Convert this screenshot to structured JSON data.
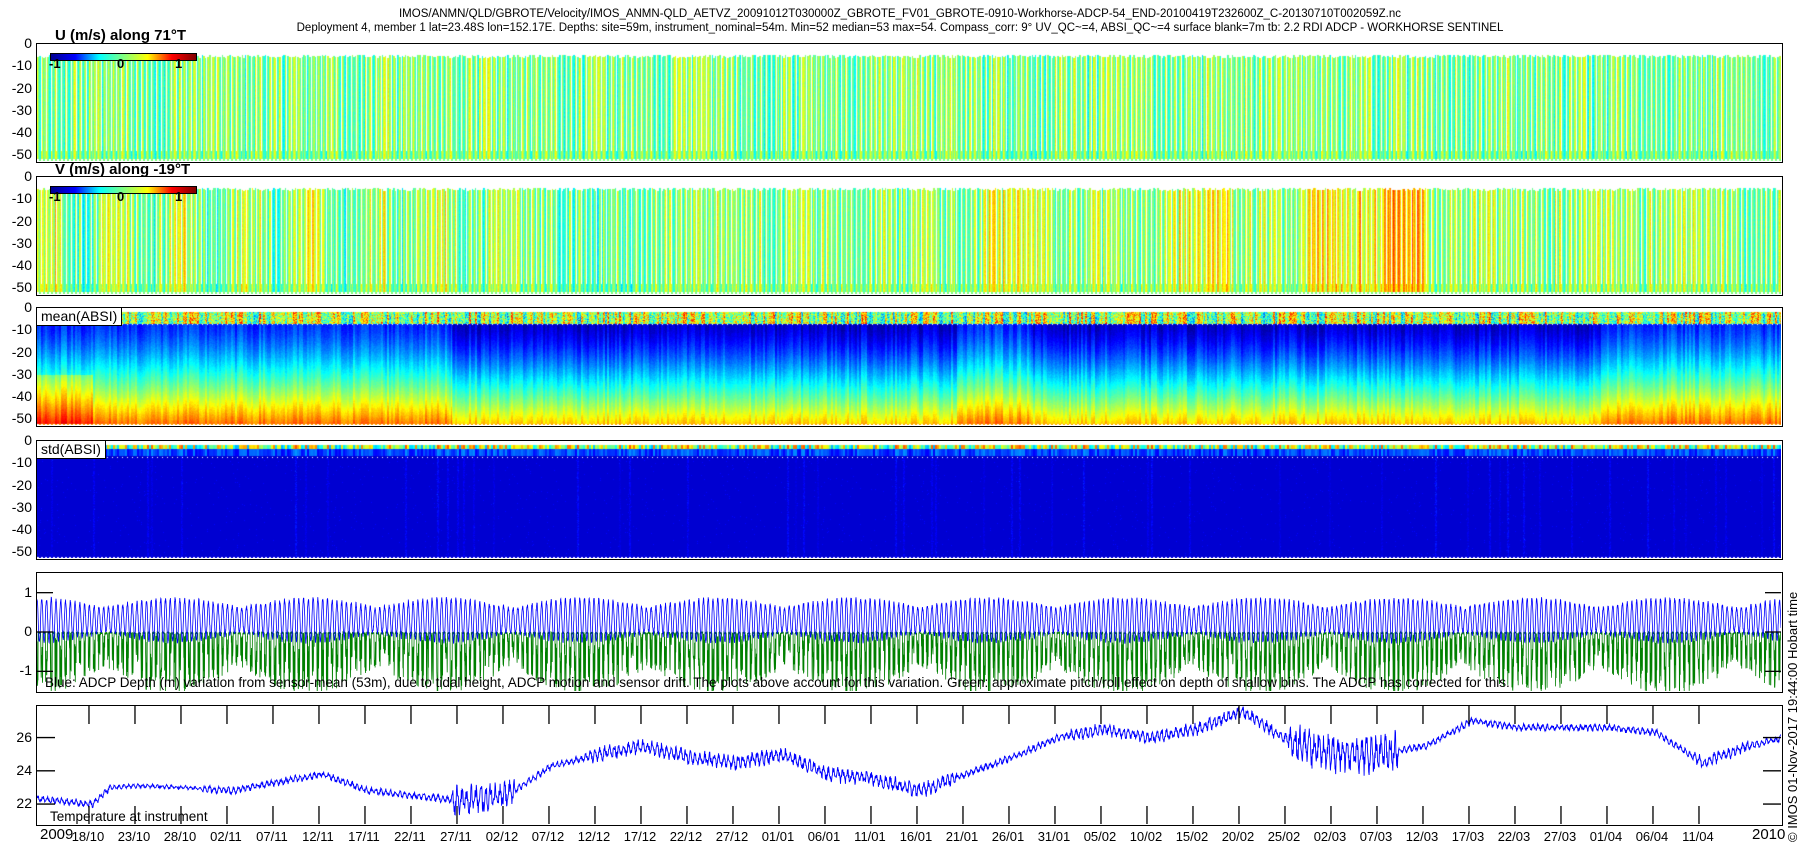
{
  "title": {
    "line1": "IMOS/ANMN/QLD/GBROTE/Velocity/IMOS_ANMN-QLD_AETVZ_20091012T030000Z_GBROTE_FV01_GBROTE-0910-Workhorse-ADCP-54_END-20100419T232600Z_C-20130710T002059Z.nc",
    "line2": "Deployment 4, member 1 lat=23.48S lon=152.17E. Depths: site=59m, instrument_nominal=54m. Min=52 median=53 max=54. Compass_corr: 9° UV_QC~=4, ABSI_QC~=4 surface blank=7m tb: 2.2 RDI ADCP - WORKHORSE SENTINEL"
  },
  "credit": "© IMOS 01-Nov-2017 19:44:00 Hobart time",
  "colors": {
    "blue_series": "#0000ff",
    "green_series": "#008000"
  },
  "chart_data": [
    {
      "type": "heatmap",
      "name": "u",
      "title": "U (m/s) along 71°T",
      "ylabel_ticks": [
        "0",
        "-10",
        "-20",
        "-30",
        "-40",
        "-50"
      ],
      "ylim": [
        -52.5,
        0
      ],
      "clim": [
        -1.3,
        1.3
      ],
      "colorbar_ticks": [
        "-1",
        "0",
        "1"
      ],
      "colormap": "jet"
    },
    {
      "type": "heatmap",
      "name": "v",
      "title": "V (m/s) along -19°T",
      "ylabel_ticks": [
        "0",
        "-10",
        "-20",
        "-30",
        "-40",
        "-50"
      ],
      "ylim": [
        -52.5,
        0
      ],
      "clim": [
        -1.3,
        1.3
      ],
      "colorbar_ticks": [
        "-1",
        "0",
        "1"
      ],
      "colormap": "jet"
    },
    {
      "type": "heatmap",
      "name": "mean-absi",
      "label": "mean(ABSI)",
      "ylabel_ticks": [
        "0",
        "-10",
        "-20",
        "-30",
        "-40",
        "-50"
      ],
      "ylim": [
        -52.5,
        0
      ],
      "surface_blank_m": -7,
      "colormap": "jet"
    },
    {
      "type": "heatmap",
      "name": "std-absi",
      "label": "std(ABSI)",
      "ylabel_ticks": [
        "0",
        "-10",
        "-20",
        "-30",
        "-40",
        "-50"
      ],
      "ylim": [
        -52.5,
        0
      ],
      "surface_blank_m": -7,
      "colormap": "jet"
    },
    {
      "type": "line",
      "name": "depth-variation",
      "ylabel_ticks": [
        "1",
        "0",
        "-1"
      ],
      "ylim": [
        -1.5,
        1.5
      ],
      "caption": "Blue: ADCP Depth (m) variation from sensor-mean (53m), due to tidal height, ADCP motion and sensor drift. The plots above account for this variation. Green: approximate pitch/roll effect on depth of shallow bins. The ADCP has corrected for this.",
      "series": [
        {
          "name": "ADCP depth variation",
          "color": "blue"
        },
        {
          "name": "pitch/roll effect",
          "color": "green"
        }
      ]
    },
    {
      "type": "line",
      "name": "temperature",
      "label": "Temperature at instrument",
      "ylabel_ticks": [
        "26",
        "24",
        "22"
      ],
      "ylim": [
        20.8,
        27.9
      ],
      "x_days": [
        0,
        6,
        8,
        11,
        16,
        21,
        26,
        31,
        36,
        41,
        46,
        51,
        56,
        61,
        66,
        71,
        76,
        81,
        86,
        91,
        96,
        101,
        106,
        111,
        116,
        121,
        126,
        131,
        136,
        141,
        146,
        151,
        156,
        161,
        166,
        171,
        176,
        181,
        186,
        190
      ],
      "values": [
        22.3,
        22.0,
        23.0,
        23.1,
        23.0,
        22.8,
        23.3,
        23.8,
        22.8,
        22.5,
        22.2,
        22.5,
        24.3,
        25.0,
        25.5,
        24.8,
        24.5,
        25.0,
        23.8,
        23.5,
        22.8,
        23.8,
        24.8,
        26.0,
        26.5,
        26.0,
        26.5,
        27.6,
        25.8,
        25.0,
        25.0,
        25.5,
        27.0,
        26.6,
        26.6,
        26.6,
        26.3,
        24.5,
        25.5,
        26.0
      ]
    }
  ],
  "xaxis": {
    "start_year": "2009",
    "end_year": "2010",
    "ticks": [
      "18/10",
      "23/10",
      "28/10",
      "02/11",
      "07/11",
      "12/11",
      "17/11",
      "22/11",
      "27/11",
      "02/12",
      "07/12",
      "12/12",
      "17/12",
      "22/12",
      "27/12",
      "01/01",
      "06/01",
      "11/01",
      "16/01",
      "21/01",
      "26/01",
      "31/01",
      "05/02",
      "10/02",
      "15/02",
      "20/02",
      "25/02",
      "02/03",
      "07/03",
      "12/03",
      "17/03",
      "22/03",
      "27/03",
      "01/04",
      "06/04",
      "11/04"
    ]
  }
}
